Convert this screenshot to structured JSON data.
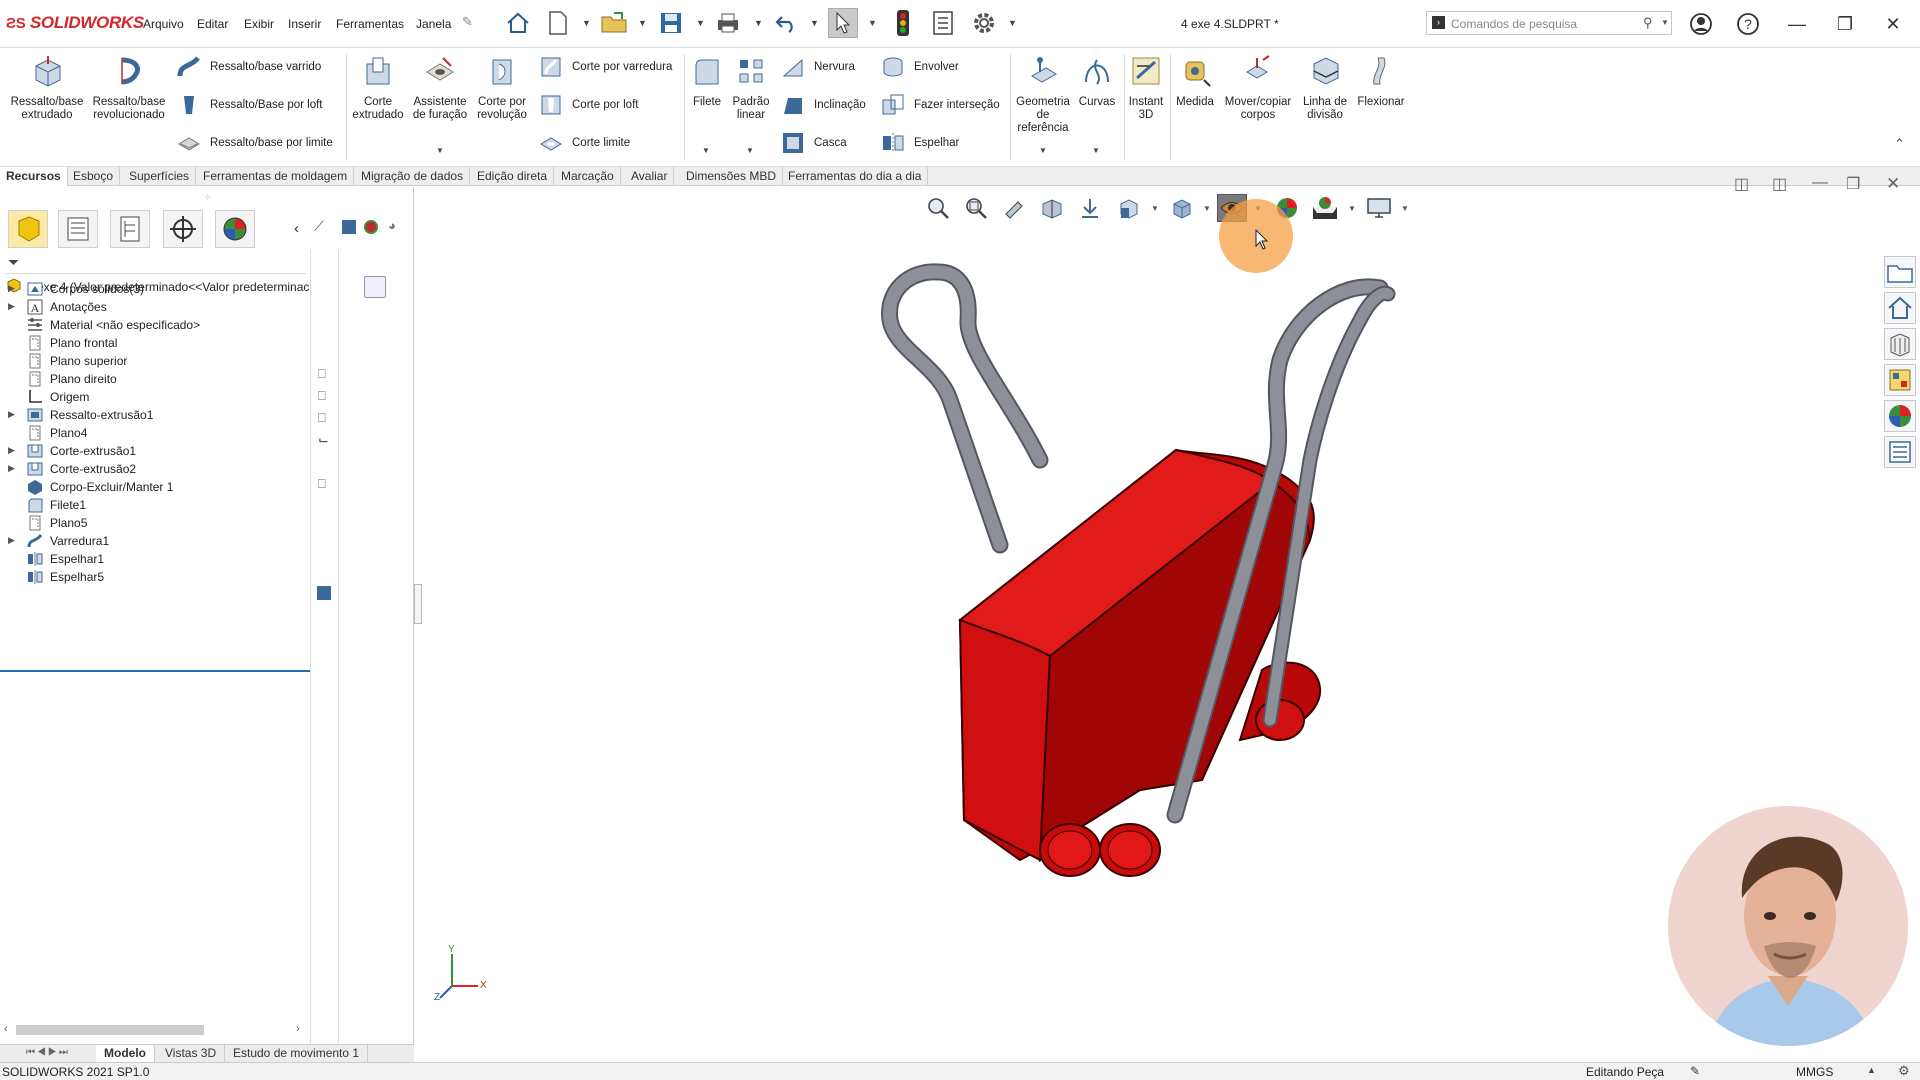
{
  "app": {
    "brand": "SOLIDWORKS",
    "document_title": "4 exe 4.SLDPRT *",
    "menu": [
      "Arquivo",
      "Editar",
      "Exibir",
      "Inserir",
      "Ferramentas",
      "Janela"
    ],
    "search_placeholder": "Comandos de pesquisa"
  },
  "ribbon": {
    "big_buttons": [
      {
        "label": "Ressalto/base extrudado"
      },
      {
        "label": "Ressalto/base revolucionado"
      },
      {
        "label": "Corte extrudado"
      },
      {
        "label": "Assistente de furação"
      },
      {
        "label": "Corte por revolução"
      },
      {
        "label": "Filete"
      },
      {
        "label": "Padrão linear"
      },
      {
        "label": "Geometria de referência"
      },
      {
        "label": "Curvas"
      },
      {
        "label": "Instant 3D"
      },
      {
        "label": "Medida"
      },
      {
        "label": "Mover/copiar corpos"
      },
      {
        "label": "Linha de divisão"
      },
      {
        "label": "Flexionar"
      }
    ],
    "rows": {
      "boss": [
        "Ressalto/base varrido",
        "Ressalto/Base por loft",
        "Ressalto/base por limite"
      ],
      "cut": [
        "Corte por varredura",
        "Corte por loft",
        "Corte limite"
      ],
      "features": [
        "Nervura",
        "Inclinação",
        "Casca"
      ],
      "features2": [
        "Envolver",
        "Fazer interseção",
        "Espelhar"
      ]
    }
  },
  "command_tabs": [
    "Recursos",
    "Esboço",
    "Superfícies",
    "Ferramentas de moldagem",
    "Migração de dados",
    "Edição direta",
    "Marcação",
    "Avaliar",
    "Dimensões MBD",
    "Ferramentas do dia a dia"
  ],
  "feature_tree": {
    "root": "4 exe 4  (Valor predeterminado<<Valor predeterminac",
    "items": [
      {
        "label": "Corpos sólidos(3)",
        "expandable": true,
        "icon": "solid-bodies-folder-icon"
      },
      {
        "label": "Anotações",
        "expandable": true,
        "icon": "annotations-icon"
      },
      {
        "label": "Material <não especificado>",
        "expandable": false,
        "icon": "material-icon"
      },
      {
        "label": "Plano frontal",
        "expandable": false,
        "icon": "plane-icon"
      },
      {
        "label": "Plano superior",
        "expandable": false,
        "icon": "plane-icon"
      },
      {
        "label": "Plano direito",
        "expandable": false,
        "icon": "plane-icon"
      },
      {
        "label": "Origem",
        "expandable": false,
        "icon": "origin-icon"
      },
      {
        "label": "Ressalto-extrusão1",
        "expandable": true,
        "icon": "extrude-icon"
      },
      {
        "label": "Plano4",
        "expandable": false,
        "icon": "plane-icon"
      },
      {
        "label": "Corte-extrusão1",
        "expandable": true,
        "icon": "cut-extrude-icon"
      },
      {
        "label": "Corte-extrusão2",
        "expandable": true,
        "icon": "cut-extrude-icon"
      },
      {
        "label": "Corpo-Excluir/Manter 1",
        "expandable": false,
        "icon": "delete-body-icon"
      },
      {
        "label": "Filete1",
        "expandable": false,
        "icon": "fillet-icon"
      },
      {
        "label": "Plano5",
        "expandable": false,
        "icon": "plane-icon"
      },
      {
        "label": "Varredura1",
        "expandable": true,
        "icon": "sweep-icon"
      },
      {
        "label": "Espelhar1",
        "expandable": false,
        "icon": "mirror-icon"
      },
      {
        "label": "Espelhar5",
        "expandable": false,
        "icon": "mirror-icon"
      }
    ]
  },
  "bottom_tabs": [
    "Modelo",
    "Vistas 3D",
    "Estudo de movimento 1"
  ],
  "status": {
    "version": "SOLIDWORKS 2021 SP1.0",
    "mode": "Editando Peça",
    "units": "MMGS"
  },
  "triad": {
    "x": "X",
    "y": "Y",
    "z": "Z"
  },
  "colors": {
    "brand_red": "#d5262c",
    "part_red": "#d40d0d",
    "clip_gray": "#8e9099",
    "accent_blue": "#1e6fb5"
  }
}
